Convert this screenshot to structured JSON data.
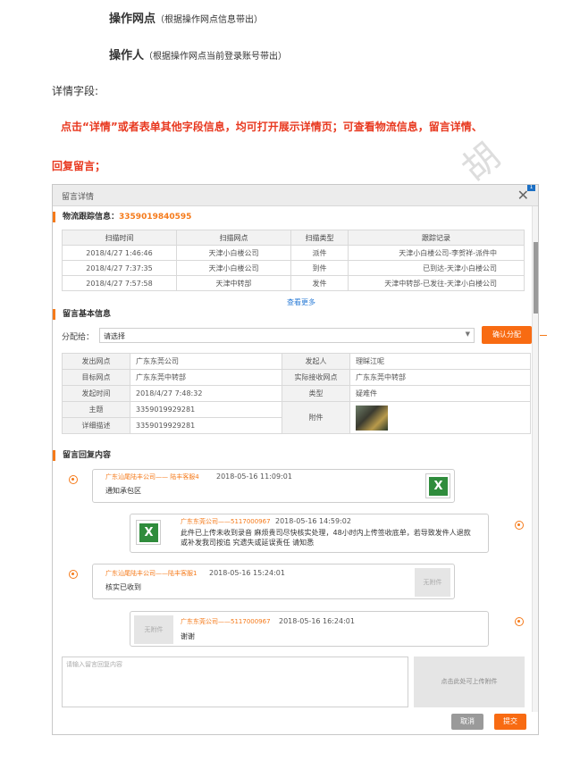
{
  "doc": {
    "line1_bold": "操作网点",
    "line1_note": "（根据操作网点信息带出）",
    "line2_bold": "操作人",
    "line2_note": "（根据操作网点当前登录账号带出）",
    "details_label": "详情字段:",
    "red_line1": "点击“详情”或者表单其他字段信息，均可打开展示详情页；可查看物流信息，留言详情、",
    "red_line2": "回复留言；",
    "watermark": "胡"
  },
  "modal": {
    "title": "留言详情",
    "badge": "1",
    "tracking_label": "物流跟踪信息：",
    "tracking_no": "3359019840595",
    "track_headers": [
      "扫描时间",
      "扫描网点",
      "扫描类型",
      "跟踪记录"
    ],
    "track_rows": [
      [
        "2018/4/27 1:46:46",
        "天津小白楼公司",
        "派件",
        "天津小白楼公司-李贺祥-派件中"
      ],
      [
        "2018/4/27 7:37:35",
        "天津小白楼公司",
        "到件",
        "已到达-天津小白楼公司"
      ],
      [
        "2018/4/27 7:57:58",
        "天津中转部",
        "发件",
        "天津中转部-已发往-天津小白楼公司"
      ]
    ],
    "see_more": "查看更多",
    "basic_title": "留言基本信息",
    "assign_label": "分配给：",
    "assign_value": "请选择",
    "confirm_assign": "确认分配",
    "info": {
      "send_site_k": "发出网点",
      "send_site_v": "广东东莞公司",
      "initiator_k": "发起人",
      "initiator_v": "理睬江呢",
      "target_site_k": "目标网点",
      "target_site_v": "广东东莞中转部",
      "actual_site_k": "实际接收网点",
      "actual_site_v": "广东东莞中转部",
      "send_time_k": "发起时间",
      "send_time_v": "2018/4/27 7:48:32",
      "type_k": "类型",
      "type_v": "疑难件",
      "subject_k": "主题",
      "subject_v": "3359019929281",
      "attach_k": "附件",
      "desc_k": "详细描述",
      "desc_v": "3359019929281"
    },
    "reply_title": "留言回复内容",
    "replies": [
      {
        "name": "广东汕尾陆丰公司—— 陆丰客服4",
        "time": "2018-05-16 11:09:01",
        "text": "通知承包区"
      },
      {
        "name": "广东东莞公司——5117000967",
        "time": "2018-05-16 14:59:02",
        "text1": "此件已上传未收到录音 麻烦贵司尽快核实处理，48小时内上传签收底单，若导致发件人退款",
        "text2": "或补发我司按追 究遗失或延误责任 请知悉"
      },
      {
        "name": "广东汕尾陆丰公司——陆丰客服1",
        "time": "2018-05-16 15:24:01",
        "text": "核实已收到",
        "noatt": "无附件"
      },
      {
        "name": "广东东莞公司——5117000967",
        "time": "2018-05-16 16:24:01",
        "text": "谢谢",
        "noatt": "无附件"
      }
    ],
    "reply_placeholder": "请输入留言回复内容",
    "upload_label": "点击此处可上传附件",
    "cancel": "取消",
    "submit": "提交"
  }
}
